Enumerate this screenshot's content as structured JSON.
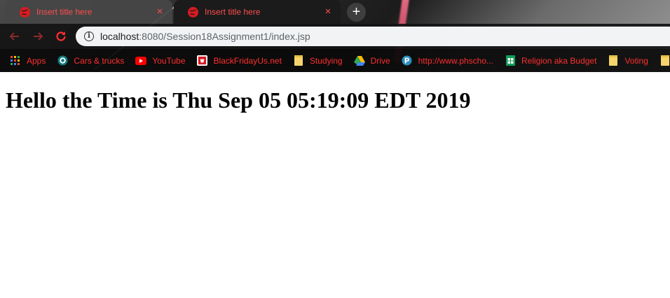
{
  "tabs": [
    {
      "title": "Insert title here",
      "close": "×"
    },
    {
      "title": "Insert title here",
      "close": "×"
    }
  ],
  "new_tab_label": "+",
  "address": {
    "host": "localhost",
    "path": ":8080/Session18Assignment1/index.jsp",
    "info_icon": "i"
  },
  "bookmarks": [
    {
      "label": "Apps",
      "icon": "apps-grid-icon"
    },
    {
      "label": "Cars & trucks",
      "icon": "circle-logo-icon"
    },
    {
      "label": "YouTube",
      "icon": "youtube-icon"
    },
    {
      "label": "BlackFridayUs.net",
      "icon": "blackfriday-icon"
    },
    {
      "label": "Studying",
      "icon": "folder-icon"
    },
    {
      "label": "Drive",
      "icon": "drive-icon"
    },
    {
      "label": "http://www.phscho...",
      "icon": "pinterest-icon"
    },
    {
      "label": "Religion aka Budget",
      "icon": "sheets-icon"
    },
    {
      "label": "Voting",
      "icon": "folder-icon"
    }
  ],
  "page": {
    "heading": "Hello the Time is Thu Sep 05 05:19:09 EDT 2019"
  },
  "colors": {
    "accent_red": "#ff2e2e",
    "tab_icon_red": "#d81b22"
  }
}
